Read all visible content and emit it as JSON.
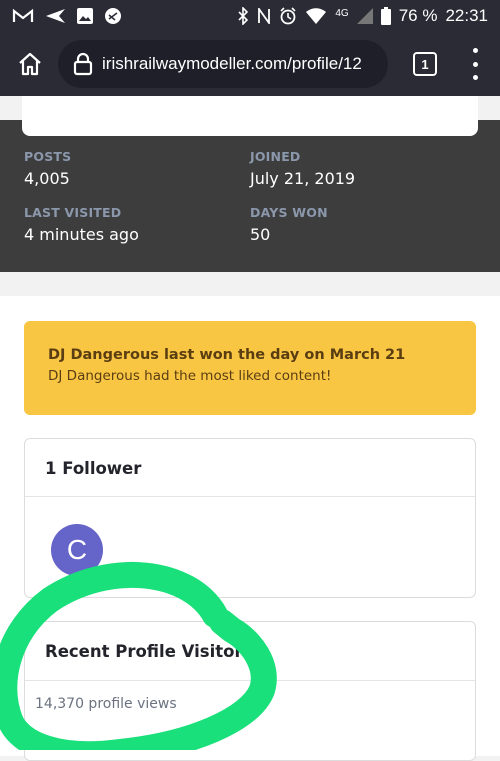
{
  "status_bar": {
    "battery": "76 %",
    "time": "22:31",
    "network": "4G",
    "icons": [
      "gmail-icon",
      "send-icon",
      "image-icon",
      "app-icon",
      "bluetooth-icon",
      "nfc-icon",
      "alarm-icon",
      "wifi-icon",
      "signal-icon",
      "battery-icon"
    ]
  },
  "browser": {
    "url": "irishrailwaymodeller.com/profile/12",
    "tab_count": "1"
  },
  "stats": {
    "posts_label": "POSTS",
    "posts_value": "4,005",
    "joined_label": "JOINED",
    "joined_value": "July 21, 2019",
    "last_visited_label": "LAST VISITED",
    "last_visited_value": "4 minutes ago",
    "days_won_label": "DAYS WON",
    "days_won_value": "50"
  },
  "trophy": {
    "title": "DJ Dangerous last won the day on March 21",
    "subtitle": "DJ Dangerous had the most liked content!"
  },
  "followers": {
    "heading": "1 Follower",
    "avatar_letter": "C"
  },
  "visitors": {
    "heading": "Recent Profile Visitors",
    "views": "14,370 profile views"
  },
  "colors": {
    "browser_bar": "#2b2b36",
    "stats_bg": "#3d3d3d",
    "trophy_bg": "#f9c644",
    "avatar": "#6565c9",
    "scribble": "#19e07a"
  }
}
